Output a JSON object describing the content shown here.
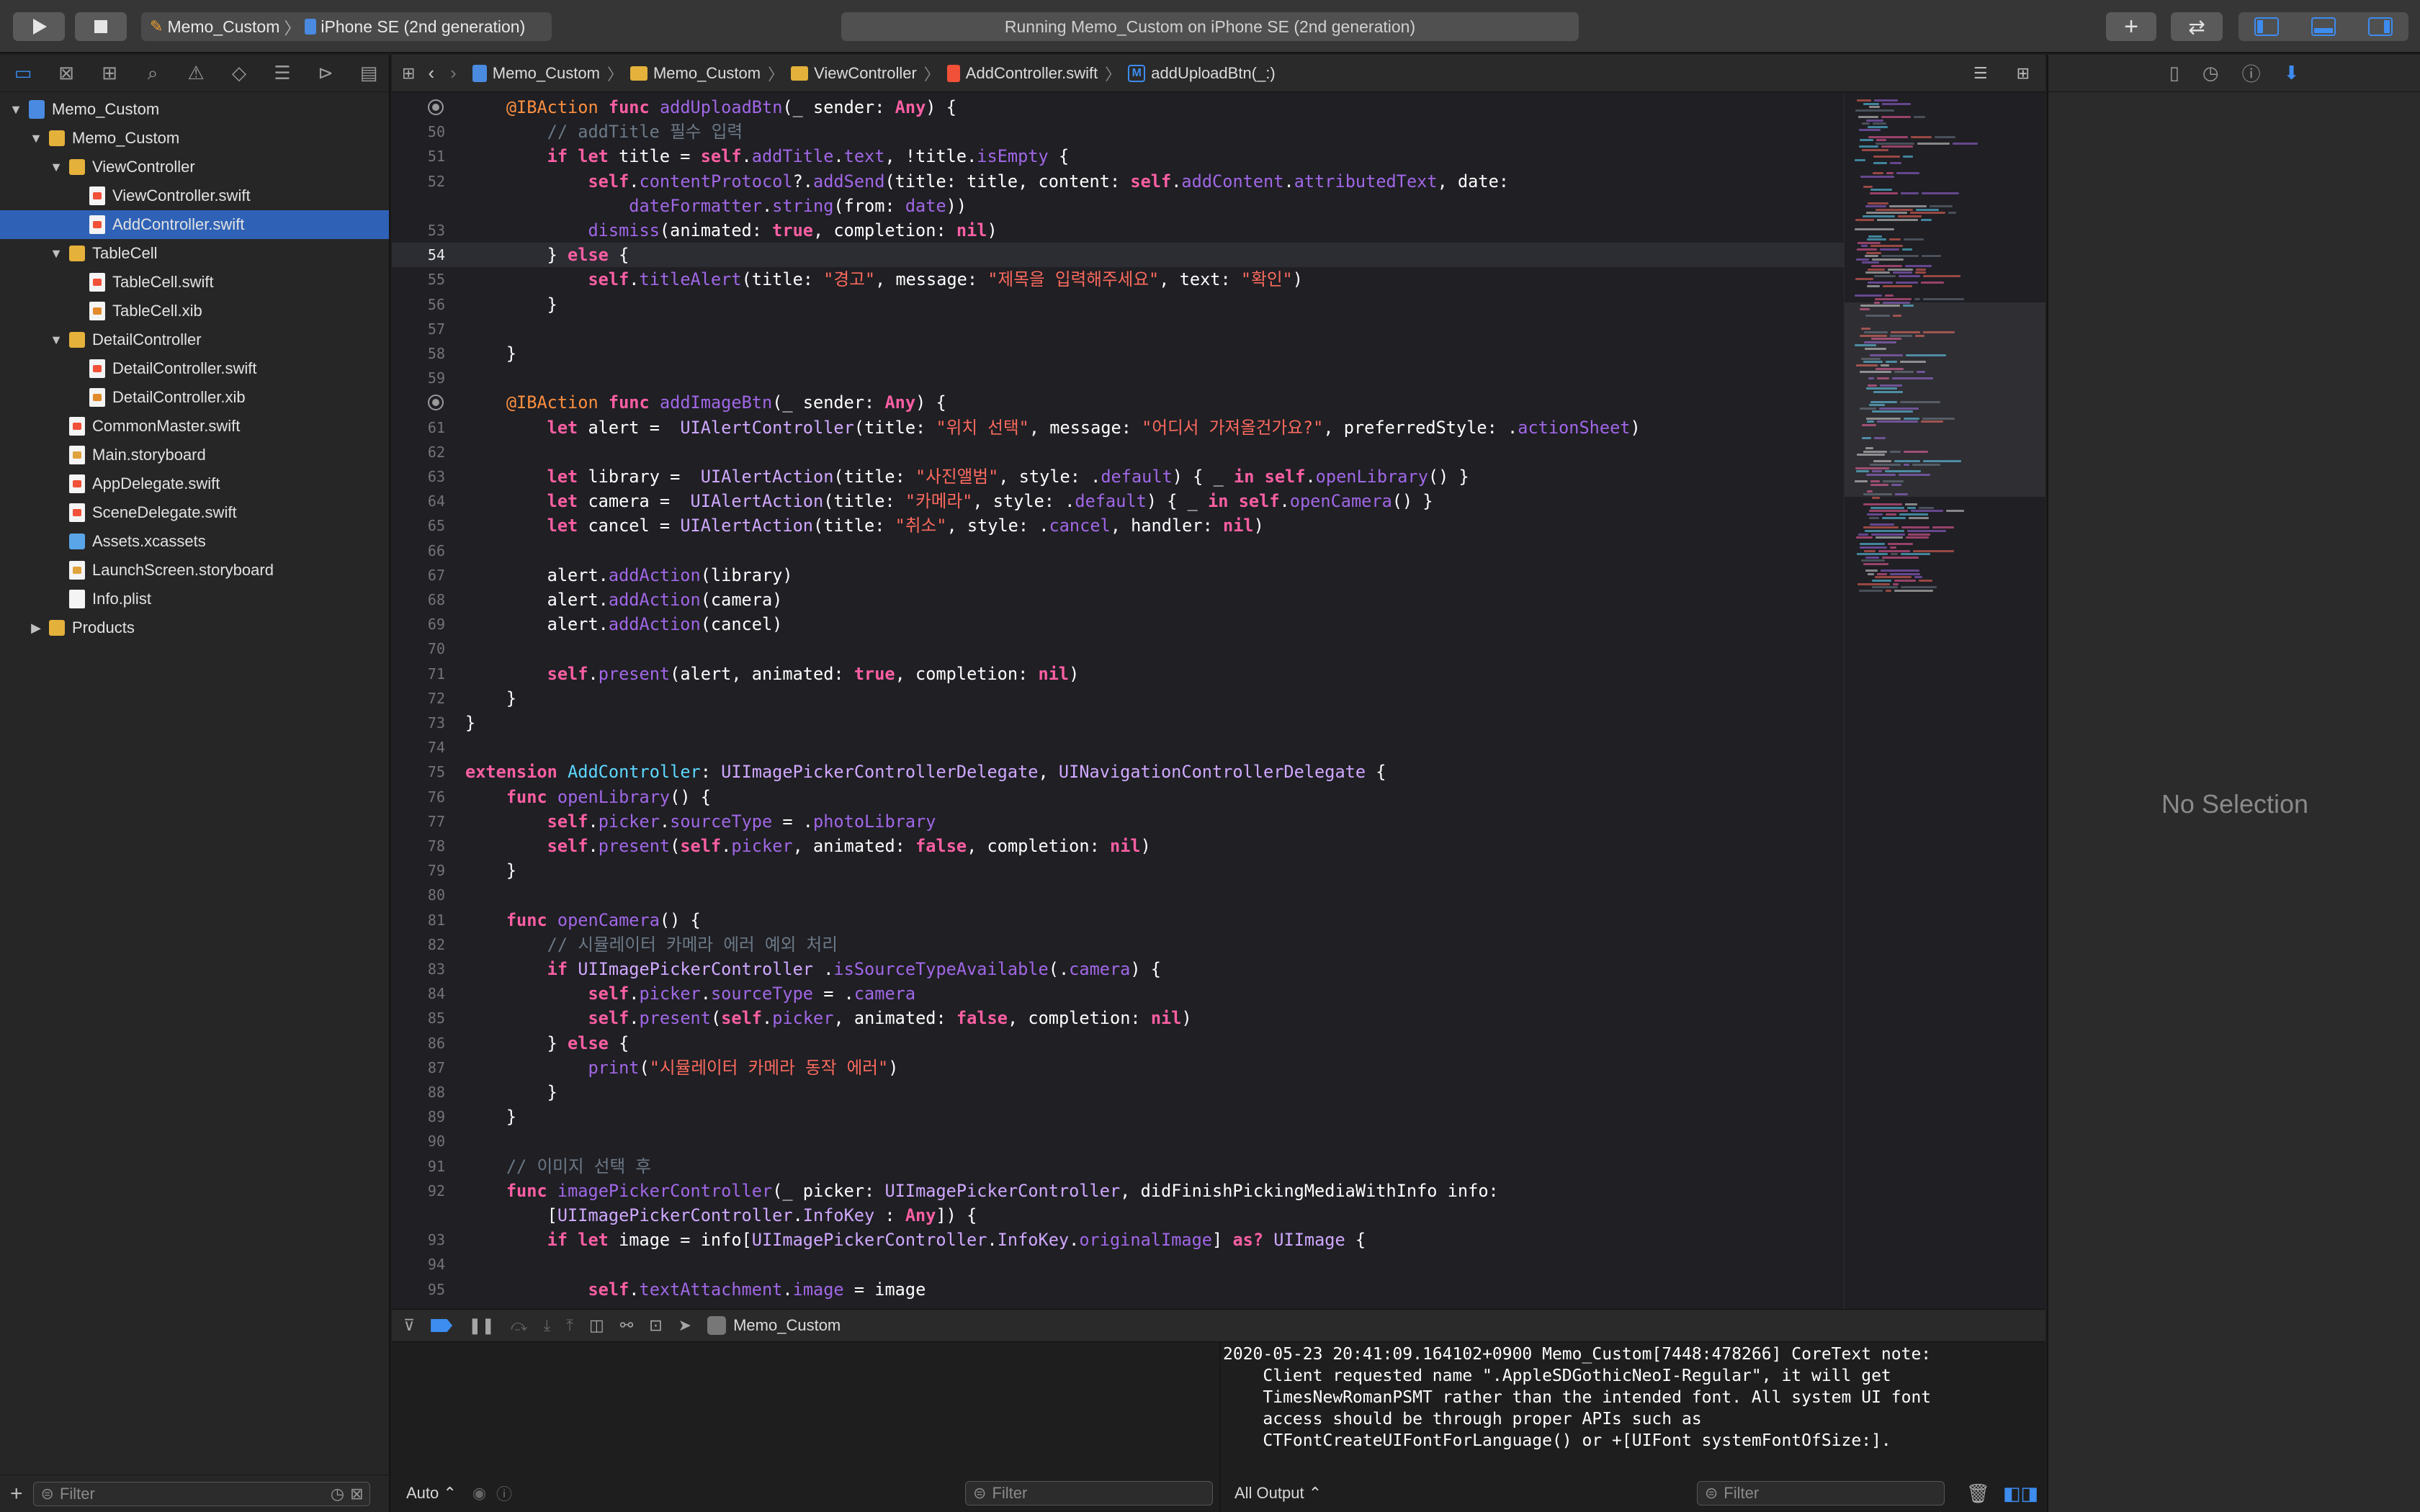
{
  "toolbar": {
    "scheme": "Memo_Custom",
    "device": "iPhone SE (2nd generation)",
    "status": "Running Memo_Custom on iPhone SE (2nd generation)",
    "add_icon": "+"
  },
  "navigator": {
    "items": [
      {
        "label": "Memo_Custom",
        "kind": "project",
        "depth": 0,
        "open": true
      },
      {
        "label": "Memo_Custom",
        "kind": "folder",
        "depth": 1,
        "open": true
      },
      {
        "label": "ViewController",
        "kind": "folder",
        "depth": 2,
        "open": true
      },
      {
        "label": "ViewController.swift",
        "kind": "swift",
        "depth": 3
      },
      {
        "label": "AddController.swift",
        "kind": "swift",
        "depth": 3,
        "selected": true
      },
      {
        "label": "TableCell",
        "kind": "folder",
        "depth": 2,
        "open": true
      },
      {
        "label": "TableCell.swift",
        "kind": "swift",
        "depth": 3
      },
      {
        "label": "TableCell.xib",
        "kind": "xib",
        "depth": 3
      },
      {
        "label": "DetailController",
        "kind": "folder",
        "depth": 2,
        "open": true
      },
      {
        "label": "DetailController.swift",
        "kind": "swift",
        "depth": 3
      },
      {
        "label": "DetailController.xib",
        "kind": "xib",
        "depth": 3
      },
      {
        "label": "CommonMaster.swift",
        "kind": "swift",
        "depth": 2
      },
      {
        "label": "Main.storyboard",
        "kind": "sb",
        "depth": 2
      },
      {
        "label": "AppDelegate.swift",
        "kind": "swift",
        "depth": 2
      },
      {
        "label": "SceneDelegate.swift",
        "kind": "swift",
        "depth": 2
      },
      {
        "label": "Assets.xcassets",
        "kind": "asset",
        "depth": 2
      },
      {
        "label": "LaunchScreen.storyboard",
        "kind": "sb",
        "depth": 2
      },
      {
        "label": "Info.plist",
        "kind": "plist",
        "depth": 2
      },
      {
        "label": "Products",
        "kind": "folder",
        "depth": 1,
        "open": false
      }
    ],
    "filter_placeholder": "Filter"
  },
  "jumpbar": {
    "crumbs": [
      "Memo_Custom",
      "Memo_Custom",
      "ViewController",
      "AddController.swift",
      "addUploadBtn(_:)"
    ],
    "method_badge": "M"
  },
  "editor": {
    "current_line": "54",
    "breakpoint_lines": [
      "49",
      "60"
    ],
    "lines": [
      {
        "n": "",
        "html": "    <span class='at'>@IBAction</span> <span class='kw'>func</span> <span class='fn'>addUploadBtn</span>(_ sender: <span class='kw'>Any</span>) {"
      },
      {
        "n": "50",
        "html": "        <span class='cm'>// addTitle 필수 입력</span>"
      },
      {
        "n": "51",
        "html": "        <span class='kw'>if let</span> title = <span class='kw'>self</span>.<span class='pr'>addTitle</span>.<span class='pr'>text</span>, !title.<span class='pr'>isEmpty</span> {"
      },
      {
        "n": "52",
        "html": "            <span class='kw'>self</span>.<span class='pr'>contentProtocol</span>?.<span class='pr'>addSend</span>(title: title, content: <span class='kw'>self</span>.<span class='pr'>addContent</span>.<span class='pr'>attributedText</span>, date:"
      },
      {
        "n": "",
        "html": "                <span class='pr'>dateFormatter</span>.<span class='pr'>string</span>(from: <span class='pr'>date</span>))"
      },
      {
        "n": "53",
        "html": "            <span class='pr'>dismiss</span>(animated: <span class='kw'>true</span>, completion: <span class='kw'>nil</span>)"
      },
      {
        "n": "54",
        "html": "        } <span class='kw'>else</span> {"
      },
      {
        "n": "55",
        "html": "            <span class='kw'>self</span>.<span class='pr'>titleAlert</span>(title: <span class='str'>\"경고\"</span>, message: <span class='str'>\"제목을 입력해주세요\"</span>, text: <span class='str'>\"확인\"</span>)"
      },
      {
        "n": "56",
        "html": "        }"
      },
      {
        "n": "57",
        "html": ""
      },
      {
        "n": "58",
        "html": "    }"
      },
      {
        "n": "59",
        "html": ""
      },
      {
        "n": "",
        "html": "    <span class='at'>@IBAction</span> <span class='kw'>func</span> <span class='fn'>addImageBtn</span>(_ sender: <span class='kw'>Any</span>) {"
      },
      {
        "n": "61",
        "html": "        <span class='kw'>let</span> alert =  <span class='tyd'>UIAlertController</span>(title: <span class='str'>\"위치 선택\"</span>, message: <span class='str'>\"어디서 가져올건가요?\"</span>, preferredStyle: .<span class='pr'>actionSheet</span>)"
      },
      {
        "n": "62",
        "html": ""
      },
      {
        "n": "63",
        "html": "        <span class='kw'>let</span> library =  <span class='tyd'>UIAlertAction</span>(title: <span class='str'>\"사진앨범\"</span>, style: .<span class='pr'>default</span>) { _ <span class='kw'>in self</span>.<span class='pr'>openLibrary</span>() }"
      },
      {
        "n": "64",
        "html": "        <span class='kw'>let</span> camera =  <span class='tyd'>UIAlertAction</span>(title: <span class='str'>\"카메라\"</span>, style: .<span class='pr'>default</span>) { _ <span class='kw'>in self</span>.<span class='pr'>openCamera</span>() }"
      },
      {
        "n": "65",
        "html": "        <span class='kw'>let</span> cancel = <span class='tyd'>UIAlertAction</span>(title: <span class='str'>\"취소\"</span>, style: .<span class='pr'>cancel</span>, handler: <span class='kw'>nil</span>)"
      },
      {
        "n": "66",
        "html": ""
      },
      {
        "n": "67",
        "html": "        alert.<span class='pr'>addAction</span>(library)"
      },
      {
        "n": "68",
        "html": "        alert.<span class='pr'>addAction</span>(camera)"
      },
      {
        "n": "69",
        "html": "        alert.<span class='pr'>addAction</span>(cancel)"
      },
      {
        "n": "70",
        "html": ""
      },
      {
        "n": "71",
        "html": "        <span class='kw'>self</span>.<span class='pr'>present</span>(alert, animated: <span class='kw'>true</span>, completion: <span class='kw'>nil</span>)"
      },
      {
        "n": "72",
        "html": "    }"
      },
      {
        "n": "73",
        "html": "}"
      },
      {
        "n": "74",
        "html": ""
      },
      {
        "n": "75",
        "html": "<span class='kw'>extension</span> <span class='ty'>AddController</span>: <span class='tyd'>UIImagePickerControllerDelegate</span>, <span class='tyd'>UINavigationControllerDelegate</span> {"
      },
      {
        "n": "76",
        "html": "    <span class='kw'>func</span> <span class='fn'>openLibrary</span>() {"
      },
      {
        "n": "77",
        "html": "        <span class='kw'>self</span>.<span class='pr'>picker</span>.<span class='pr'>sourceType</span> = .<span class='pr'>photoLibrary</span>"
      },
      {
        "n": "78",
        "html": "        <span class='kw'>self</span>.<span class='pr'>present</span>(<span class='kw'>self</span>.<span class='pr'>picker</span>, animated: <span class='kw'>false</span>, completion: <span class='kw'>nil</span>)"
      },
      {
        "n": "79",
        "html": "    }"
      },
      {
        "n": "80",
        "html": ""
      },
      {
        "n": "81",
        "html": "    <span class='kw'>func</span> <span class='fn'>openCamera</span>() {"
      },
      {
        "n": "82",
        "html": "        <span class='cm'>// 시뮬레이터 카메라 에러 예외 처리</span>"
      },
      {
        "n": "83",
        "html": "        <span class='kw'>if</span> <span class='tyd'>UIImagePickerController</span> .<span class='pr'>isSourceTypeAvailable</span>(.<span class='pr'>camera</span>) {"
      },
      {
        "n": "84",
        "html": "            <span class='kw'>self</span>.<span class='pr'>picker</span>.<span class='pr'>sourceType</span> = .<span class='pr'>camera</span>"
      },
      {
        "n": "85",
        "html": "            <span class='kw'>self</span>.<span class='pr'>present</span>(<span class='kw'>self</span>.<span class='pr'>picker</span>, animated: <span class='kw'>false</span>, completion: <span class='kw'>nil</span>)"
      },
      {
        "n": "86",
        "html": "        } <span class='kw'>else</span> {"
      },
      {
        "n": "87",
        "html": "            <span class='pr'>print</span>(<span class='str'>\"시뮬레이터 카메라 동작 에러\"</span>)"
      },
      {
        "n": "88",
        "html": "        }"
      },
      {
        "n": "89",
        "html": "    }"
      },
      {
        "n": "90",
        "html": ""
      },
      {
        "n": "91",
        "html": "    <span class='cm'>// 이미지 선택 후</span>"
      },
      {
        "n": "92",
        "html": "    <span class='kw'>func</span> <span class='fn'>imagePickerController</span>(_ picker: <span class='tyd'>UIImagePickerController</span>, didFinishPickingMediaWithInfo info:"
      },
      {
        "n": "",
        "html": "        [<span class='tyd'>UIImagePickerController</span>.<span class='tyd'>InfoKey</span> : <span class='kw'>Any</span>]) {"
      },
      {
        "n": "93",
        "html": "        <span class='kw'>if let</span> image = info[<span class='tyd'>UIImagePickerController</span>.<span class='tyd'>InfoKey</span>.<span class='pr'>originalImage</span>] <span class='kw'>as?</span> <span class='tyd'>UIImage</span> {"
      },
      {
        "n": "94",
        "html": ""
      },
      {
        "n": "95",
        "html": "            <span class='kw'>self</span>.<span class='pr'>textAttachment</span>.<span class='pr'>image</span> = image"
      }
    ]
  },
  "debugbar": {
    "target": "Memo_Custom"
  },
  "variables": {
    "scope": "Auto"
  },
  "console": {
    "text": "2020-05-23 20:41:09.164102+0900 Memo_Custom[7448:478266] CoreText note:\n    Client requested name \".AppleSDGothicNeoI-Regular\", it will get\n    TimesNewRomanPSMT rather than the intended font. All system UI font\n    access should be through proper APIs such as\n    CTFontCreateUIFontForLanguage() or +[UIFont systemFontOfSize:].",
    "output_mode": "All Output",
    "filter_placeholder": "Filter",
    "var_filter_placeholder": "Filter"
  },
  "inspector": {
    "empty_label": "No Selection"
  }
}
